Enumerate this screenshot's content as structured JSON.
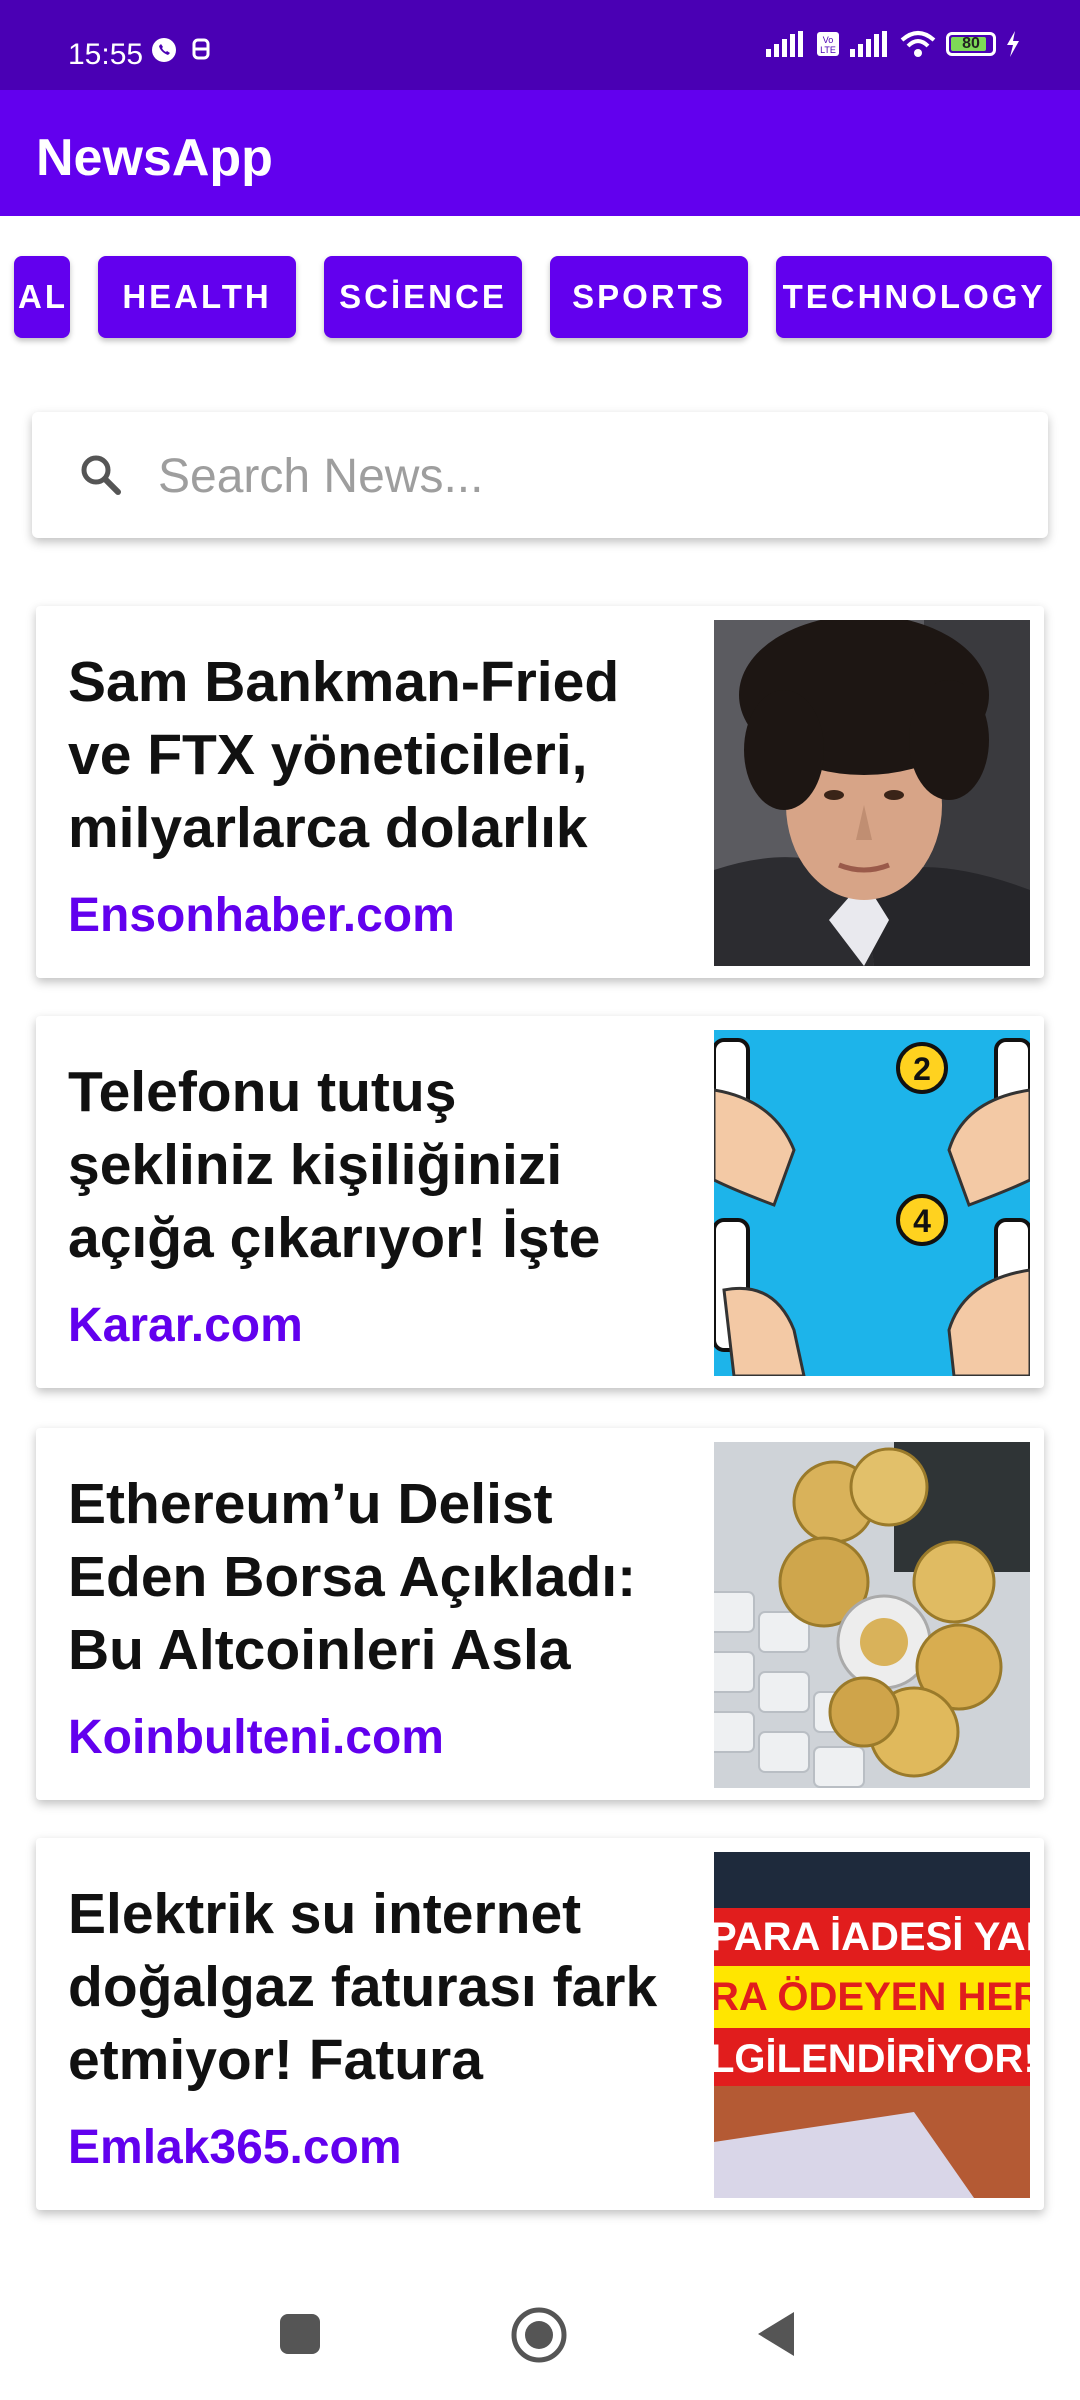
{
  "status_bar": {
    "time": "15:55",
    "battery": "80"
  },
  "app": {
    "title": "NewsApp"
  },
  "categories": [
    {
      "label": "AL"
    },
    {
      "label": "HEALTH"
    },
    {
      "label": "SCİENCE"
    },
    {
      "label": "SPORTS"
    },
    {
      "label": "TECHNOLOGY"
    }
  ],
  "search": {
    "placeholder": "Search News..."
  },
  "news": [
    {
      "title": "Sam Bankman-Fried ve FTX yöneticileri, milyarlarca dolarlık",
      "source": "Ensonhaber.com",
      "image": "portrait-photo"
    },
    {
      "title": "Telefonu tutuş şekliniz kişiliğinizi açığa çıkarıyor! İşte",
      "source": "Karar.com",
      "image": "phone-grip-illustration"
    },
    {
      "title": "Ethereum’u Delist Eden Borsa Açıkladı: Bu Altcoinleri Asla",
      "source": "Koinbulteni.com",
      "image": "crypto-coins-photo"
    },
    {
      "title": "Elektrik su internet doğalgaz faturası fark etmiyor! Fatura",
      "source": "Emlak365.com",
      "image": "refund-banner-photo",
      "image_text": [
        "PARA İADESİ YAPIL",
        "RA ÖDEYEN HERK",
        "LGİLENDİRİYOR!!"
      ]
    }
  ],
  "colors": {
    "primary": "#6200ee",
    "status_bar": "#4a00b4"
  }
}
